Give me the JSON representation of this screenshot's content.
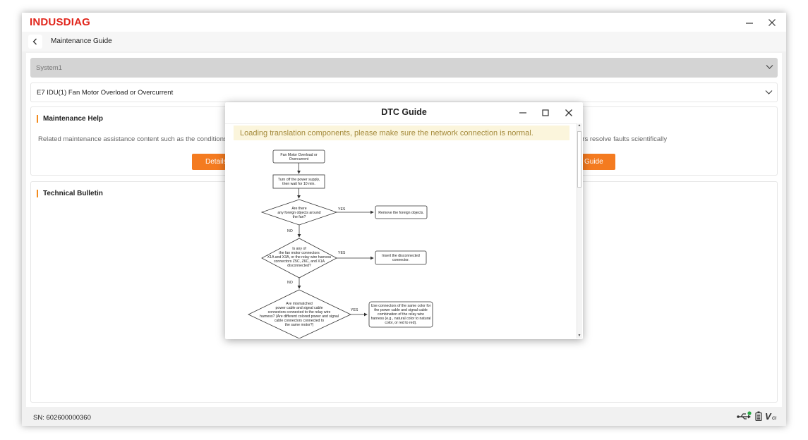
{
  "app": {
    "brand": "INDUSDIAG",
    "minimize_icon": "minimize-icon",
    "close_icon": "close-icon"
  },
  "subheader": {
    "back_icon": "chevron-left-icon",
    "title": "Maintenance Guide"
  },
  "selectors": {
    "system": "System1",
    "fault": "E7 IDU(1)  Fan Motor Overload or Overcurrent"
  },
  "maintenance_help": {
    "title": "Maintenance Help",
    "description_left": "Related maintenance assistance content such as the conditions",
    "description_right": "ers resolve faults scientifically",
    "details_button": "Details",
    "guide_button": "Guide"
  },
  "technical_bulletin": {
    "title": "Technical Bulletin"
  },
  "footer": {
    "serial": "SN: 602600000360",
    "icons": [
      "usb-connected-icon",
      "battery-icon",
      "vci-icon"
    ],
    "vci_label": "V",
    "vci_sub": "CI"
  },
  "dialog": {
    "title": "DTC Guide",
    "notice": "Loading translation components, please make sure the network connection is normal.",
    "flowchart": {
      "start": [
        "Fan Motor Overload or",
        "Overcurrent"
      ],
      "step1": [
        "Turn off the power supply,",
        "then wait for 10 min."
      ],
      "decision1": [
        "Are there",
        "any foreign objects around",
        "the fan?"
      ],
      "action1": "Remove the foreign objects.",
      "decision2": [
        "Is any of",
        "the fan motor connectors",
        "X1A and X3A, or the relay wire harness",
        "connectors Z5C, Z6C, and X1A",
        "disconnected?"
      ],
      "action2": [
        "Insert the disconnected",
        "connector."
      ],
      "decision3": [
        "Are mismatched",
        "power cable and signal cable",
        "connectors connected to the relay wire",
        "harness? (Are different colored power and signal",
        "cable connectors connected to",
        "the same motor?)"
      ],
      "action3": [
        "Use connectors of the same color for",
        "the power cable and signal cable",
        "combination of the relay wire",
        "harness (e.g., natural color to natural",
        "color, or red to red)."
      ],
      "yes": "YES",
      "no": "NO"
    }
  }
}
